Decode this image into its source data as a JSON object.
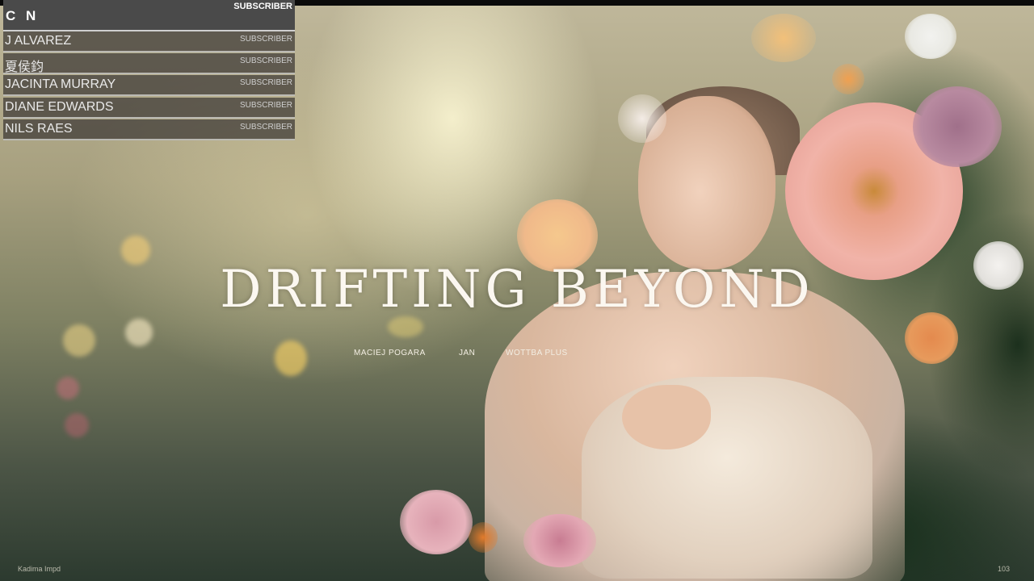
{
  "overlay": {
    "header": {
      "name": "C N",
      "role": "SUBSCRIBER"
    },
    "rows": [
      {
        "name": "J ALVAREZ",
        "role": "SUBSCRIBER"
      },
      {
        "name": "夏侯鈞",
        "role": "SUBSCRIBER"
      },
      {
        "name": "JACINTA MURRAY",
        "role": "SUBSCRIBER"
      },
      {
        "name": "DIANE EDWARDS",
        "role": "SUBSCRIBER"
      },
      {
        "name": "NILS RAES",
        "role": "SUBSCRIBER"
      }
    ]
  },
  "video": {
    "title": "DRIFTING BEYOND",
    "credits": [
      "MACIEJ POGARA",
      "JAN",
      "WOTTBA PLUS"
    ],
    "corner_left": "Kadima Impd",
    "corner_right": "103"
  },
  "colors": {
    "panel_bg": "#4a4a4a",
    "row_bg": "rgba(60,56,52,0.72)",
    "title": "#fbf7f0"
  }
}
